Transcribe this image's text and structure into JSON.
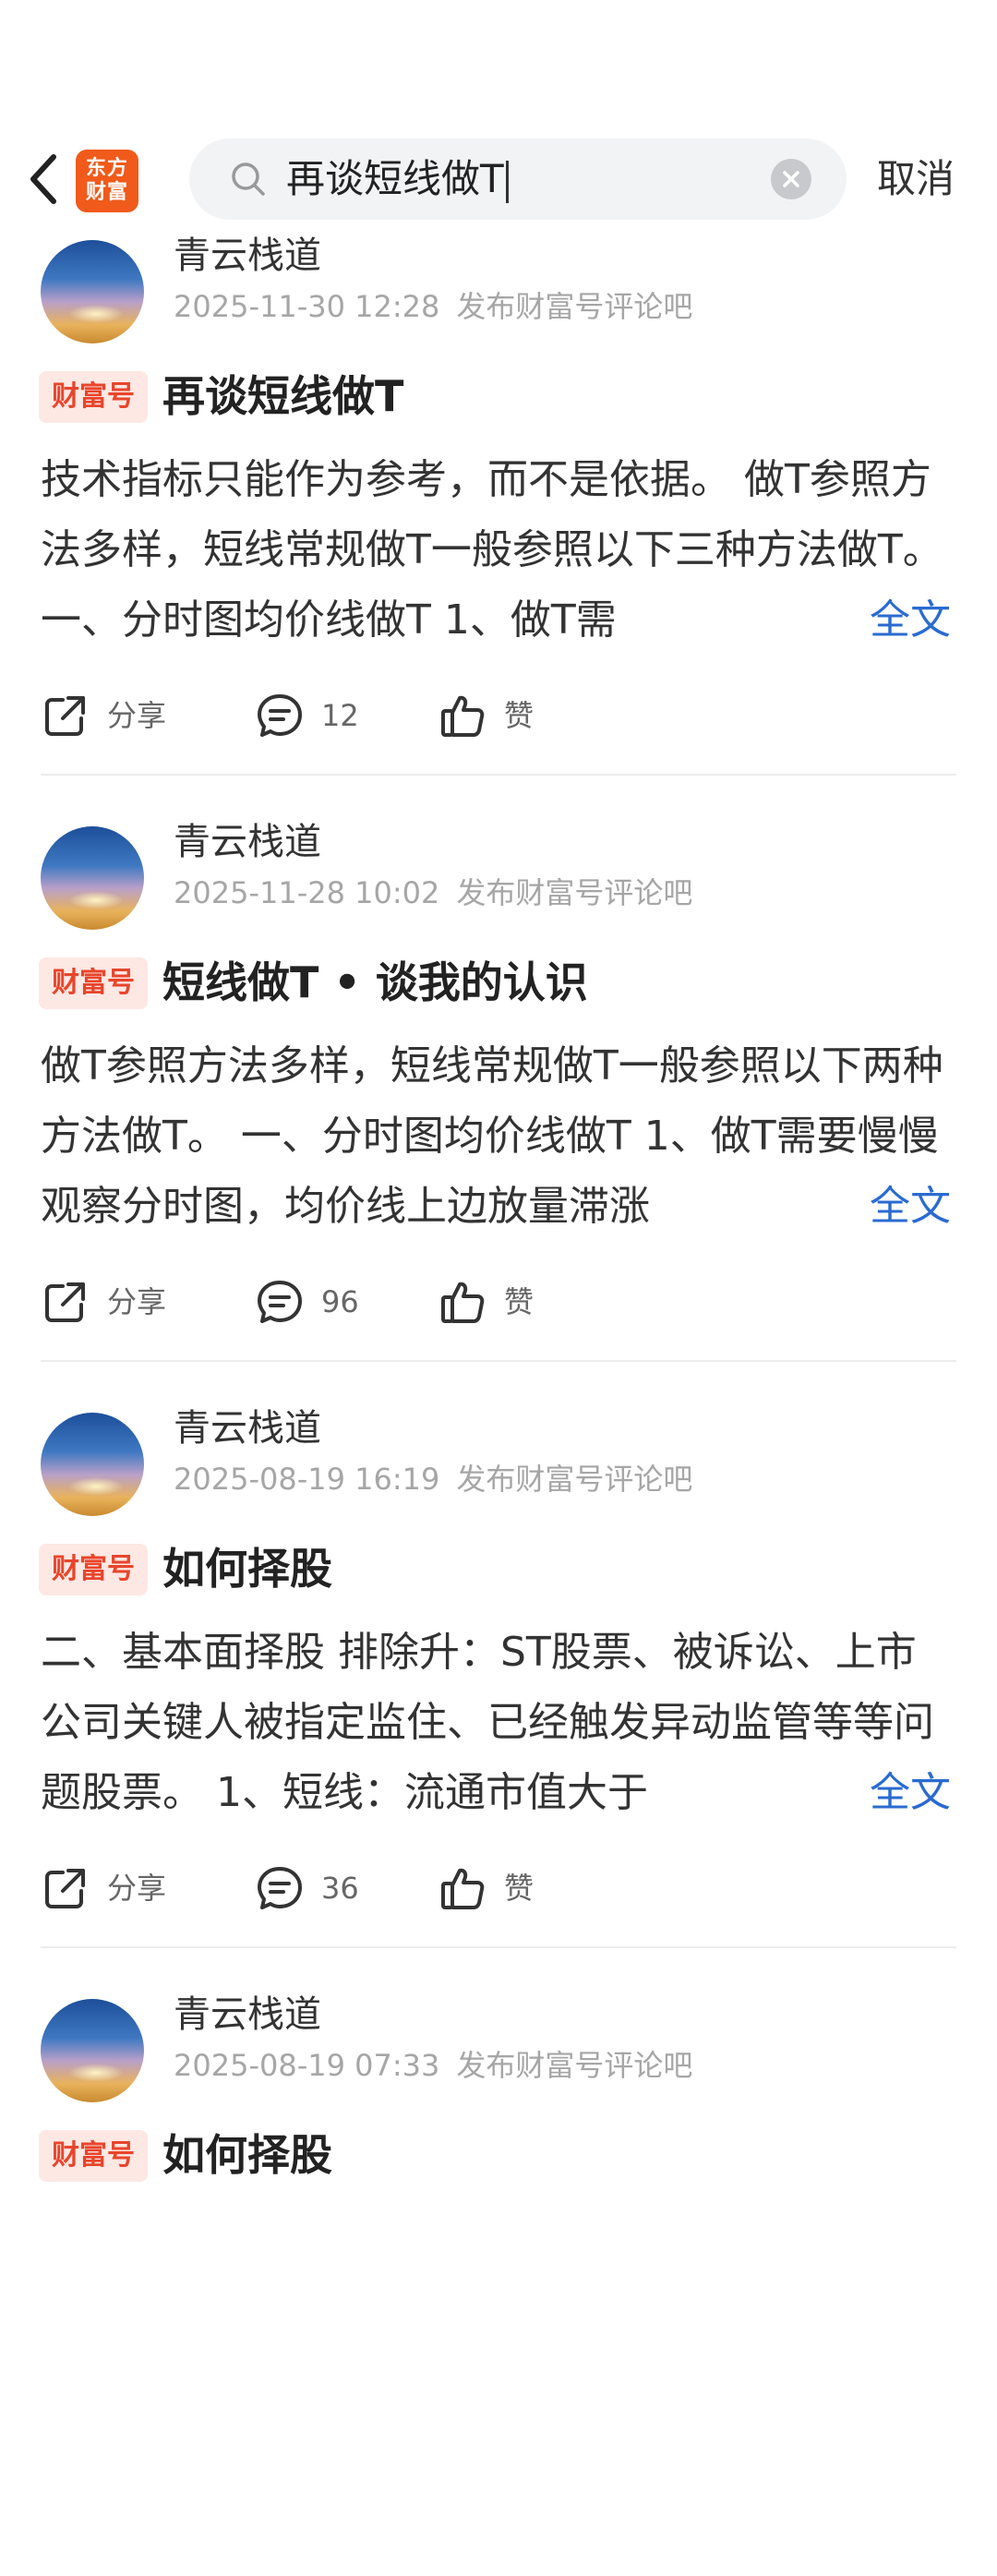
{
  "header": {
    "logo_line1": "东方",
    "logo_line2": "财富",
    "search_value": "再谈短线做T",
    "cancel_label": "取消"
  },
  "posts": [
    {
      "author": "青云栈道",
      "time": "2025-11-30 12:28",
      "source": "发布财富号评论吧",
      "badge": "财富号",
      "title": "再谈短线做T",
      "body": "技术指标只能作为参考，而不是依据。 做T参照方法多样，短线常规做T一般参照以下三种方法做T。 一、分时图均价线做T 1、做T需",
      "full_text_label": "全文",
      "share_label": "分享",
      "comments": "12",
      "like_label": "赞"
    },
    {
      "author": "青云栈道",
      "time": "2025-11-28 10:02",
      "source": "发布财富号评论吧",
      "badge": "财富号",
      "title": "短线做T • 谈我的认识",
      "body": "做T参照方法多样，短线常规做T一般参照以下两种方法做T。 一、分时图均价线做T 1、做T需要慢慢观察分时图，均价线上边放量滞涨",
      "full_text_label": "全文",
      "share_label": "分享",
      "comments": "96",
      "like_label": "赞"
    },
    {
      "author": "青云栈道",
      "time": "2025-08-19 16:19",
      "source": "发布财富号评论吧",
      "badge": "财富号",
      "title": "如何择股",
      "body": "二、基本面择股 排除升：ST股票、被诉讼、上市公司关键人被指定监住、已经触发异动监管等等问题股票。 1、短线：流通市值大于",
      "full_text_label": "全文",
      "share_label": "分享",
      "comments": "36",
      "like_label": "赞"
    },
    {
      "author": "青云栈道",
      "time": "2025-08-19 07:33",
      "source": "发布财富号评论吧",
      "badge": "财富号",
      "title": "如何择股"
    }
  ]
}
